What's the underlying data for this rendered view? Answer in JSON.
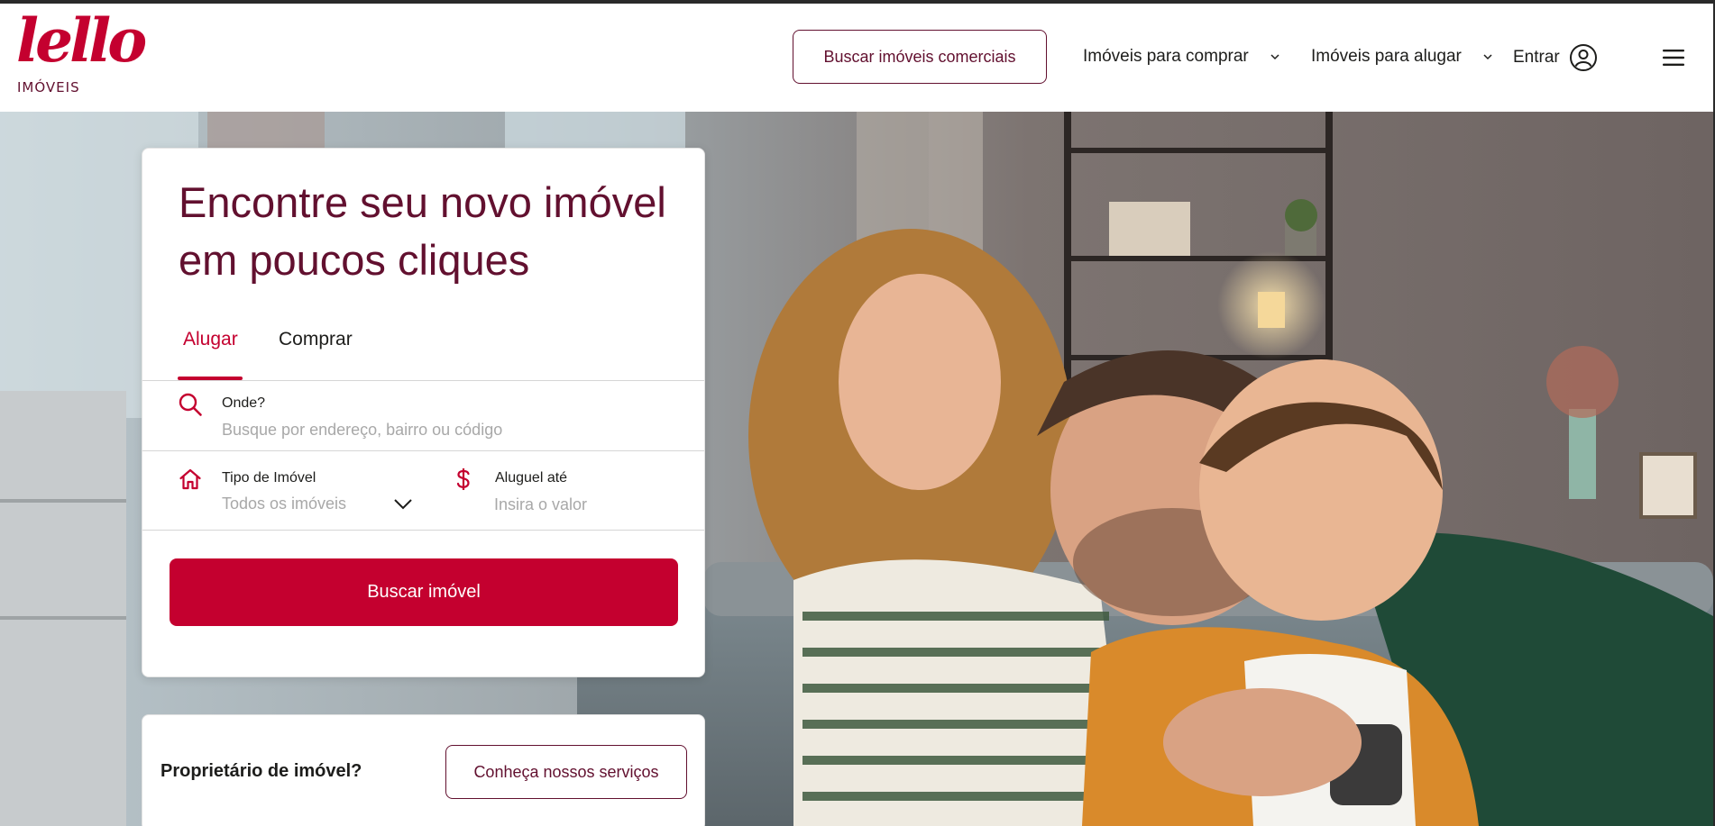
{
  "header": {
    "logo_text": "lello",
    "logo_subtext": "IMÓVEIS",
    "commercial_button": "Buscar imóveis comerciais",
    "nav": {
      "buy": "Imóveis para comprar",
      "rent": "Imóveis para alugar",
      "login": "Entrar"
    }
  },
  "search": {
    "title": "Encontre seu novo imóvel em poucos cliques",
    "tabs": [
      {
        "label": "Alugar",
        "active": true
      },
      {
        "label": "Comprar",
        "active": false
      }
    ],
    "where": {
      "label": "Onde?",
      "placeholder": "Busque por endereço, bairro ou código"
    },
    "property_type": {
      "label": "Tipo de Imóvel",
      "selected": "Todos os imóveis"
    },
    "max_rent": {
      "label": "Aluguel até",
      "placeholder": "Insira o valor"
    },
    "submit_label": "Buscar imóvel"
  },
  "owner": {
    "question": "Proprietário de imóvel?",
    "button": "Conheça nossos serviços"
  },
  "colors": {
    "brand_red": "#c4002f",
    "brand_wine": "#62102f"
  },
  "icons": {
    "search": "search-icon",
    "home": "home-icon",
    "dollar": "dollar-icon",
    "user": "user-circle-icon",
    "menu": "hamburger-menu-icon",
    "chevron": "chevron-down-icon"
  }
}
